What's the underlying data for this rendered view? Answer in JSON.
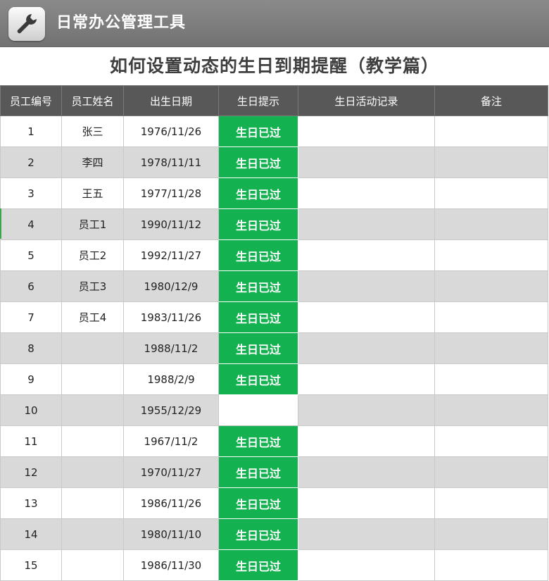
{
  "app": {
    "title": "日常办公管理工具",
    "icon": "wrench-icon"
  },
  "page_title": "如何设置动态的生日到期提醒（教学篇）",
  "table": {
    "headers": [
      "员工编号",
      "员工姓名",
      "出生日期",
      "生日提示",
      "生日活动记录",
      "备注"
    ],
    "rows": [
      {
        "id": "1",
        "name": "张三",
        "birthday": "1976/11/26",
        "tip": "生日已过",
        "record": "",
        "note": ""
      },
      {
        "id": "2",
        "name": "李四",
        "birthday": "1978/11/11",
        "tip": "生日已过",
        "record": "",
        "note": ""
      },
      {
        "id": "3",
        "name": "王五",
        "birthday": "1977/11/28",
        "tip": "生日已过",
        "record": "",
        "note": ""
      },
      {
        "id": "4",
        "name": "员工1",
        "birthday": "1990/11/12",
        "tip": "生日已过",
        "record": "",
        "note": ""
      },
      {
        "id": "5",
        "name": "员工2",
        "birthday": "1992/11/27",
        "tip": "生日已过",
        "record": "",
        "note": ""
      },
      {
        "id": "6",
        "name": "员工3",
        "birthday": "1980/12/9",
        "tip": "生日已过",
        "record": "",
        "note": ""
      },
      {
        "id": "7",
        "name": "员工4",
        "birthday": "1983/11/26",
        "tip": "生日已过",
        "record": "",
        "note": ""
      },
      {
        "id": "8",
        "name": "",
        "birthday": "1988/11/2",
        "tip": "生日已过",
        "record": "",
        "note": ""
      },
      {
        "id": "9",
        "name": "",
        "birthday": "1988/2/9",
        "tip": "生日已过",
        "record": "",
        "note": ""
      },
      {
        "id": "10",
        "name": "",
        "birthday": "1955/12/29",
        "tip": "",
        "record": "",
        "note": ""
      },
      {
        "id": "11",
        "name": "",
        "birthday": "1967/11/2",
        "tip": "生日已过",
        "record": "",
        "note": ""
      },
      {
        "id": "12",
        "name": "",
        "birthday": "1970/11/27",
        "tip": "生日已过",
        "record": "",
        "note": ""
      },
      {
        "id": "13",
        "name": "",
        "birthday": "1986/11/26",
        "tip": "生日已过",
        "record": "",
        "note": ""
      },
      {
        "id": "14",
        "name": "",
        "birthday": "1980/11/10",
        "tip": "生日已过",
        "record": "",
        "note": ""
      },
      {
        "id": "15",
        "name": "",
        "birthday": "1986/11/30",
        "tip": "生日已过",
        "record": "",
        "note": ""
      }
    ]
  },
  "colors": {
    "header_bg": "#585858",
    "topbar_bg": "#7c7c7c",
    "tip_bg": "#14b150",
    "alt_row_bg": "#d9d9d9"
  }
}
